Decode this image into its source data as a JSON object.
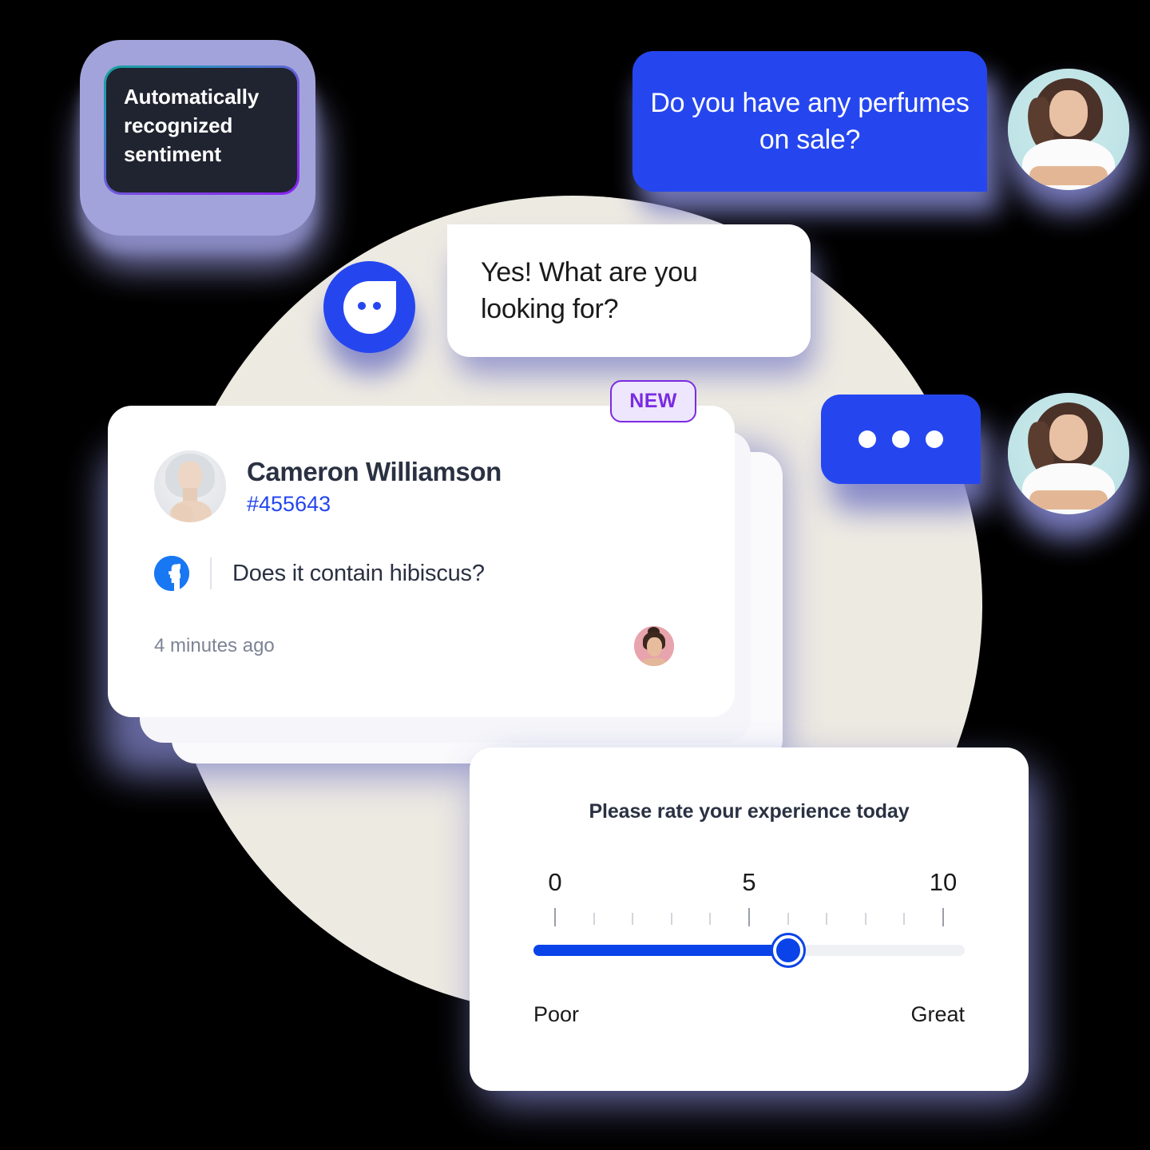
{
  "sentiment_callout": {
    "label": "Automatically recognized sentiment",
    "border_gradient_from": "#17A39B",
    "border_gradient_to": "#8B21F2",
    "box_background": "#1F2430"
  },
  "conversation": {
    "user_message": "Do you have any perfumes on sale?",
    "bot_reply": "Yes! What are you looking for?",
    "typing_indicator": "typing-dots",
    "bubble_accent": "#2546EF",
    "bot_avatar_icon": "chat-bot-icon",
    "customer_avatar_icon": "customer-avatar"
  },
  "badge": {
    "new_label": "NEW",
    "color": "#7A2BE0",
    "background": "#EDE6FC"
  },
  "message_card": {
    "contact_name": "Cameron Williamson",
    "ticket_id": "#455643",
    "channel_icon": "facebook-icon",
    "message_text": "Does it contain hibiscus?",
    "timestamp": "4 minutes ago",
    "agent_avatar_icon": "agent-avatar",
    "id_color": "#2546EF"
  },
  "survey_card": {
    "title": "Please rate your experience today",
    "scale_labels": [
      "0",
      "5",
      "10"
    ],
    "tick_count": 11,
    "major_ticks": [
      0,
      5,
      10
    ],
    "value": 6,
    "min": 0,
    "max": 10,
    "low_label": "Poor",
    "high_label": "Great",
    "fill_color": "#0A43E8",
    "track_color": "#F0F1F5"
  },
  "decor": {
    "beige_circle_color": "#EDEAE2",
    "shadow_color": "#7E81C6"
  }
}
